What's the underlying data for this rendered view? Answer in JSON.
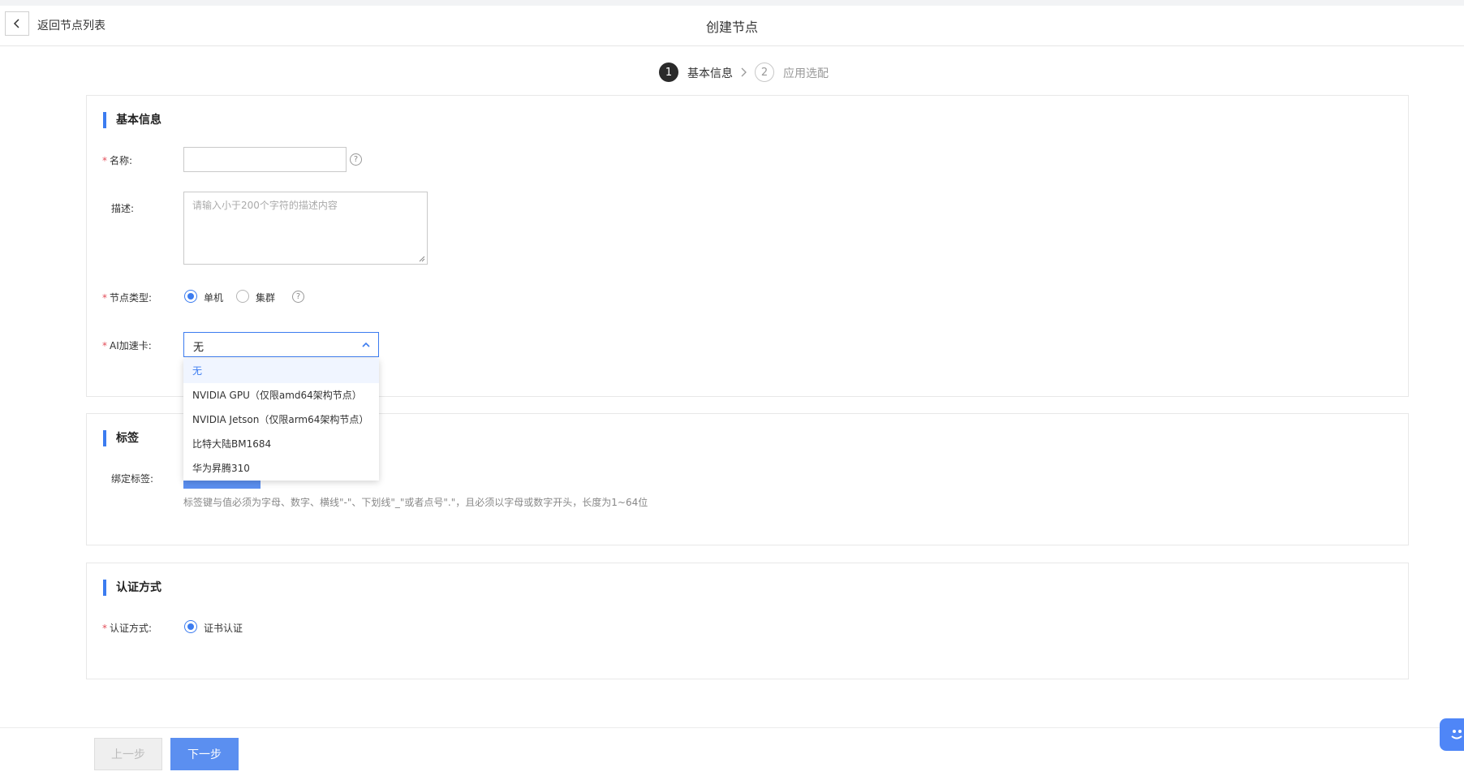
{
  "header": {
    "back_label": "返回节点列表",
    "title": "创建节点"
  },
  "steps": [
    {
      "number": "1",
      "label": "基本信息",
      "active": true
    },
    {
      "number": "2",
      "label": "应用选配",
      "active": false
    }
  ],
  "basic_info": {
    "section_title": "基本信息",
    "name": {
      "label": "名称:",
      "value": "",
      "required": true
    },
    "description": {
      "label": "描述:",
      "placeholder": "请输入小于200个字符的描述内容",
      "value": ""
    },
    "node_type": {
      "label": "节点类型:",
      "required": true,
      "options": [
        {
          "label": "单机",
          "selected": true
        },
        {
          "label": "集群",
          "selected": false
        }
      ]
    },
    "ai_card": {
      "label": "AI加速卡:",
      "required": true,
      "value": "无",
      "options": [
        {
          "label": "无",
          "selected": true
        },
        {
          "label": "NVIDIA GPU（仅限amd64架构节点）",
          "selected": false
        },
        {
          "label": "NVIDIA Jetson（仅限arm64架构节点）",
          "selected": false
        },
        {
          "label": "比特大陆BM1684",
          "selected": false
        },
        {
          "label": "华为昇腾310",
          "selected": false
        }
      ]
    }
  },
  "tags": {
    "section_title": "标签",
    "bind_label": "绑定标签:",
    "hint": "标签键与值必须为字母、数字、横线\"-\"、下划线\"_\"或者点号\".\"，且必须以字母或数字开头，长度为1~64位"
  },
  "auth": {
    "section_title": "认证方式",
    "label": "认证方式:",
    "required": true,
    "option": {
      "label": "证书认证",
      "selected": true
    }
  },
  "footer": {
    "prev_label": "上一步",
    "next_label": "下一步"
  },
  "colors": {
    "accent": "#3c7cf0",
    "primary_button": "#5b8ff0",
    "required": "#e34d59"
  }
}
